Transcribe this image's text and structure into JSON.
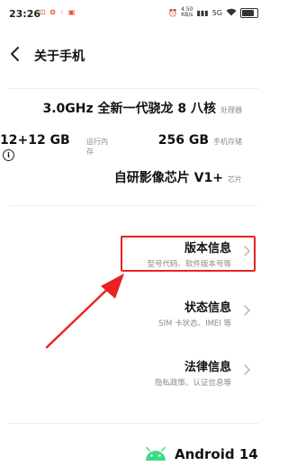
{
  "status_bar": {
    "time": "23:26",
    "left_icons": "⊡ ✿ ◦ ▣",
    "net_speed_value": "4.50",
    "net_speed_unit": "KB/s",
    "signal": "5G",
    "wifi_icon": "wifi-icon",
    "battery_level": 0.85
  },
  "nav": {
    "title": "关于手机"
  },
  "specs": {
    "processor_value": "3.0GHz 全新一代骁龙 8 八核",
    "processor_tag": "处理器",
    "ram_value": "12+12 GB",
    "ram_tag": "运行内存",
    "storage_value": "256 GB",
    "storage_tag": "手机存储",
    "chip_value": "自研影像芯片 V1+",
    "chip_tag": "芯片"
  },
  "menu": {
    "version_title": "版本信息",
    "version_sub": "型号代码、软件版本号等",
    "status_title": "状态信息",
    "status_sub": "SIM 卡状态、IMEI 等",
    "legal_title": "法律信息",
    "legal_sub": "隐私政策、认证信息等"
  },
  "footer": {
    "android_label": "Android 14"
  },
  "colors": {
    "highlight": "#e8231f",
    "android_green": "#3ddc84"
  }
}
